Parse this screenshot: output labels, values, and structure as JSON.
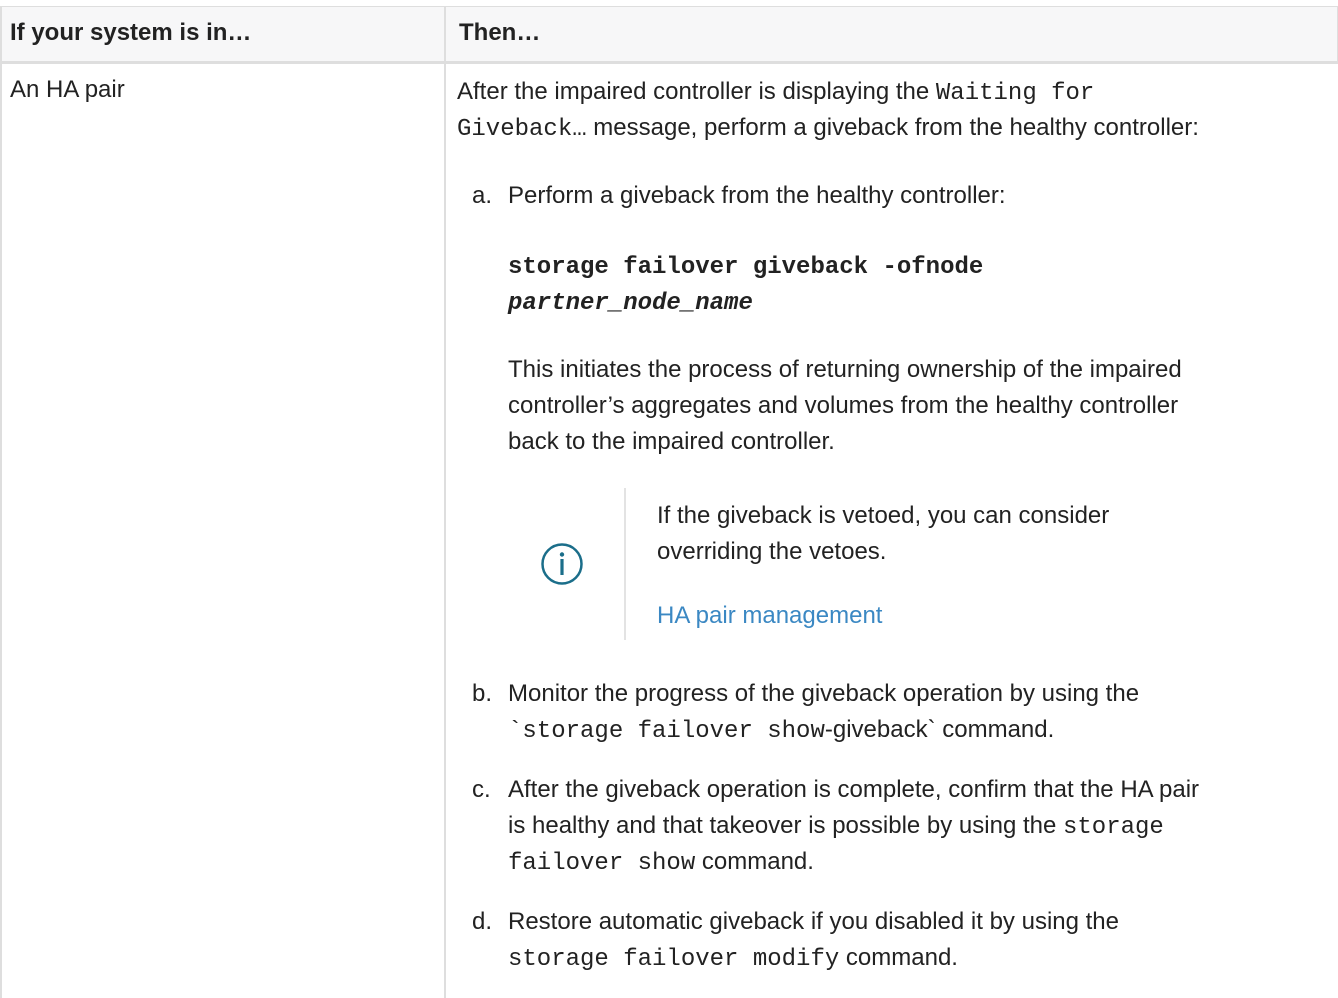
{
  "table": {
    "headers": [
      "If your system is in…",
      "Then…"
    ],
    "row_label": "An HA pair",
    "intro": {
      "line1_text": "After the impaired controller is displaying the ",
      "line1_code": "Waiting for",
      "line2_code": "Giveback…",
      "line2_text": " message, perform a giveback from the healthy controller:"
    },
    "steps": {
      "a": {
        "marker": "a.",
        "text": "Perform a giveback from the healthy controller:",
        "command_line1": "storage failover giveback -ofnode",
        "command_line2": "partner_node_name",
        "desc_line1": "This initiates the process of returning ownership of the impaired",
        "desc_line2": "controller’s aggregates and volumes from the healthy controller",
        "desc_line3": "back to the impaired controller.",
        "note": {
          "icon": "info-icon",
          "line1": "If the giveback is vetoed, you can consider",
          "line2": "overriding the vetoes.",
          "link": "HA pair management"
        }
      },
      "b": {
        "marker": "b.",
        "line1": "Monitor the progress of the giveback operation by using the",
        "line2_code": "`storage failover show",
        "line2_text": "-giveback` command."
      },
      "c": {
        "marker": "c.",
        "line1": "After the giveback operation is complete, confirm that the HA pair",
        "line2_text": "is healthy and that takeover is possible by using the ",
        "line2_code": "storage",
        "line3_code": "failover show",
        "line3_text": " command."
      },
      "d": {
        "marker": "d.",
        "line1": "Restore automatic giveback if you disabled it by using the",
        "line2_code": "storage failover modify",
        "line2_text": " command."
      }
    }
  },
  "colors": {
    "link": "#3b88c3",
    "icon": "#1b6e8a",
    "border": "#dedede",
    "header_bg": "#f7f7f8"
  }
}
